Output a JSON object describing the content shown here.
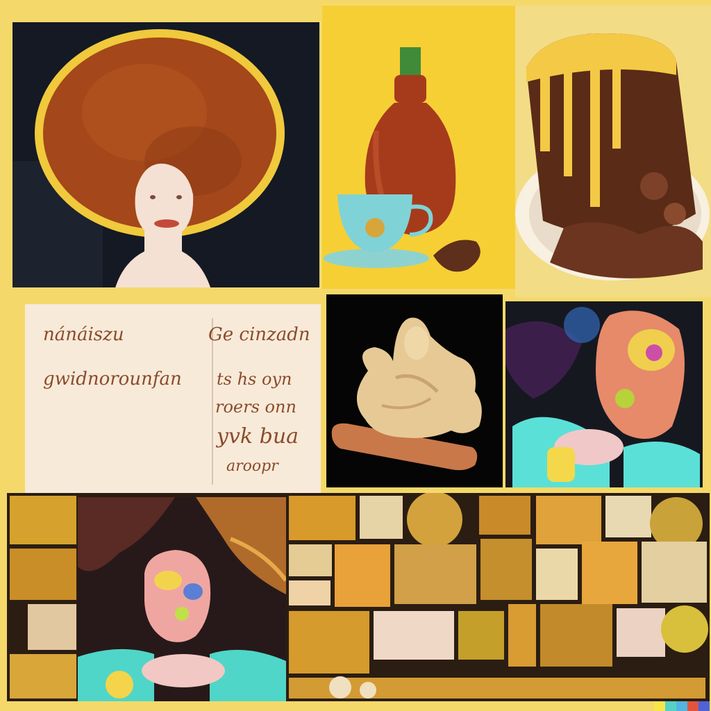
{
  "handwritten_note": {
    "lines": [
      "nánáiszu",
      "Ge cinzadn",
      "gwidnorounfan",
      "ts hs  oyn",
      "roers  onn",
      "yvk  bua",
      "aroopr"
    ]
  },
  "colors": {
    "background": "#f4d96a",
    "afro": "#a4471a",
    "afro_outline": "#f0c93c",
    "still_life_background": "#f6cf35",
    "bottle": "#a63b1c",
    "cup": "#7fd3d6",
    "cake": "#5a2b16",
    "cake_drip": "#f4c945",
    "note_paper": "#f7ead9",
    "note_ink": "#8b4b2b",
    "ginger": "#e7c996",
    "portrait_accent": "#5be0d7",
    "mosaic_gold": "#d6a22d",
    "color_strip": [
      "#f7e64a",
      "#56d1c5",
      "#52b4e0",
      "#e15540",
      "#4f62d6"
    ]
  }
}
